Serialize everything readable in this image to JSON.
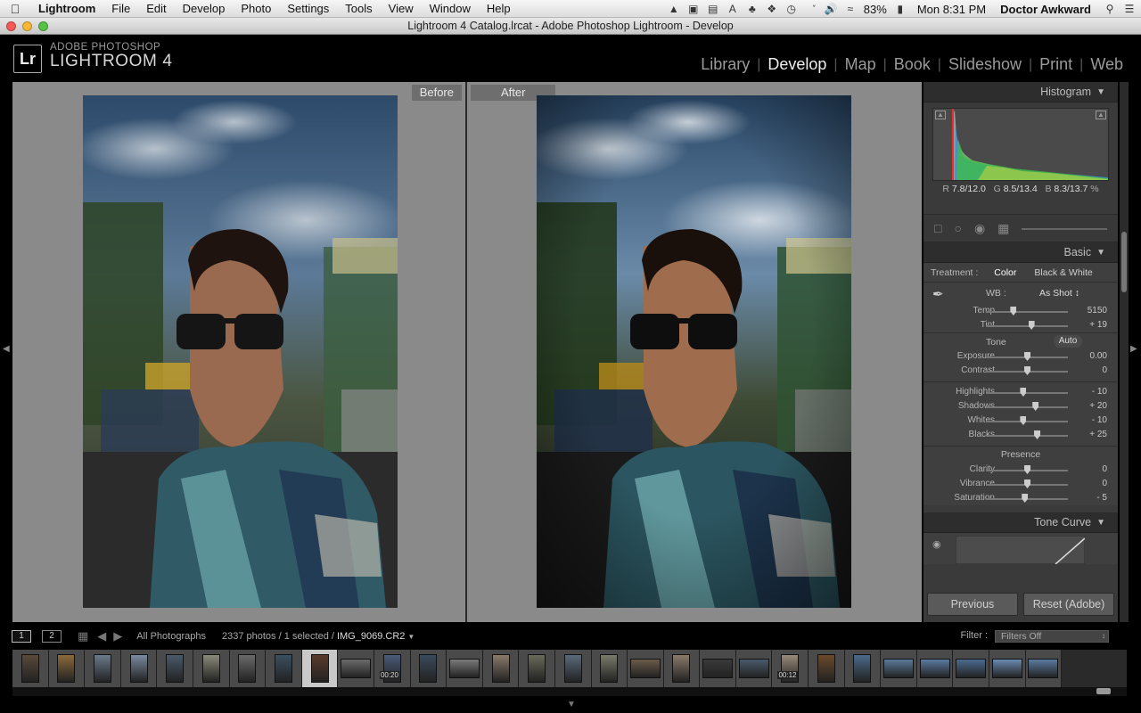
{
  "menubar": {
    "app": "Lightroom",
    "items": [
      "File",
      "Edit",
      "Develop",
      "Photo",
      "Settings",
      "Tools",
      "View",
      "Window",
      "Help"
    ],
    "battery": "83%",
    "clock": "Mon 8:31 PM",
    "user": "Doctor Awkward"
  },
  "window": {
    "title": "Lightroom 4 Catalog.lrcat - Adobe Photoshop Lightroom - Develop"
  },
  "header": {
    "logo": "Lr",
    "brand_top": "ADOBE PHOTOSHOP",
    "brand_main": "LIGHTROOM 4",
    "modules": [
      "Library",
      "Develop",
      "Map",
      "Book",
      "Slideshow",
      "Print",
      "Web"
    ],
    "active_module": "Develop"
  },
  "compare": {
    "before_label": "Before",
    "after_label": "After"
  },
  "panel": {
    "histogram": {
      "title": "Histogram",
      "r_label": "R",
      "r": "7.8/12.0",
      "g_label": "G",
      "g": "8.5/13.4",
      "b_label": "B",
      "b": "8.3/13.7",
      "pct": "%"
    },
    "basic": {
      "title": "Basic",
      "treatment_label": "Treatment :",
      "treatment_color": "Color",
      "treatment_bw": "Black & White",
      "wb_label": "WB :",
      "wb_value": "As Shot",
      "tone_label": "Tone",
      "auto_label": "Auto",
      "presence_label": "Presence",
      "sliders_wb": [
        {
          "label": "Temp",
          "value": "5150",
          "pos": 0.33
        },
        {
          "label": "Tint",
          "value": "+ 19",
          "pos": 0.55
        }
      ],
      "sliders_tone1": [
        {
          "label": "Exposure",
          "value": "0.00",
          "pos": 0.5
        },
        {
          "label": "Contrast",
          "value": "0",
          "pos": 0.5
        }
      ],
      "sliders_tone2": [
        {
          "label": "Highlights",
          "value": "- 10",
          "pos": 0.45
        },
        {
          "label": "Shadows",
          "value": "+ 20",
          "pos": 0.6
        },
        {
          "label": "Whites",
          "value": "- 10",
          "pos": 0.45
        },
        {
          "label": "Blacks",
          "value": "+ 25",
          "pos": 0.62
        }
      ],
      "sliders_presence": [
        {
          "label": "Clarity",
          "value": "0",
          "pos": 0.5
        },
        {
          "label": "Vibrance",
          "value": "0",
          "pos": 0.5
        },
        {
          "label": "Saturation",
          "value": "- 5",
          "pos": 0.47
        }
      ]
    },
    "tone_curve": {
      "title": "Tone Curve"
    },
    "previous_label": "Previous",
    "reset_label": "Reset (Adobe)"
  },
  "filmbar": {
    "page1": "1",
    "page2": "2",
    "source": "All Photographs",
    "count": "2337 photos / 1 selected /",
    "filename": "IMG_9069.CR2",
    "filter_label": "Filter :",
    "filter_value": "Filters Off"
  },
  "filmstrip": {
    "selected_index": 8,
    "durations": [
      "00:20",
      "00:12"
    ]
  },
  "colors": {
    "accent": "#eeeeee",
    "panel": "#3a3a3a"
  }
}
